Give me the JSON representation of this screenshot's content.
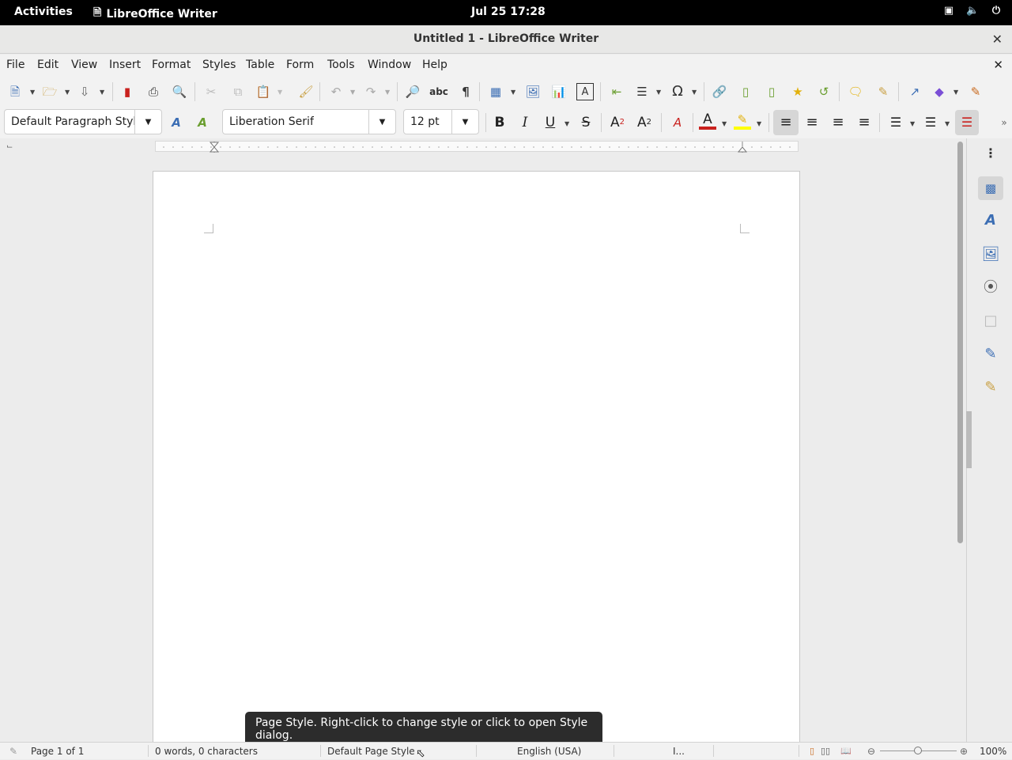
{
  "topbar": {
    "activities": "Activities",
    "app_name": "LibreOffice Writer",
    "clock": "Jul 25  17:28"
  },
  "window": {
    "title": "Untitled 1 - LibreOffice Writer",
    "close_glyph": "✕"
  },
  "menu": {
    "items": [
      "File",
      "Edit",
      "View",
      "Insert",
      "Format",
      "Styles",
      "Table",
      "Form",
      "Tools",
      "Window",
      "Help"
    ]
  },
  "formatting": {
    "paragraph_style": "Default Paragraph Style",
    "font_name": "Liberation Serif",
    "font_size": "12 pt"
  },
  "statusbar": {
    "page": "Page 1 of 1",
    "words": "0 words, 0 characters",
    "page_style": "Default Page Style",
    "language": "English (USA)",
    "insert_mode": "I...",
    "zoom": "100%"
  },
  "tooltip": {
    "text": "Page Style. Right-click to change style or click to open Style dialog."
  },
  "colors": {
    "font_color": "#c9211e",
    "highlight_color": "#ffff00",
    "accent": "#3c6eb4"
  }
}
